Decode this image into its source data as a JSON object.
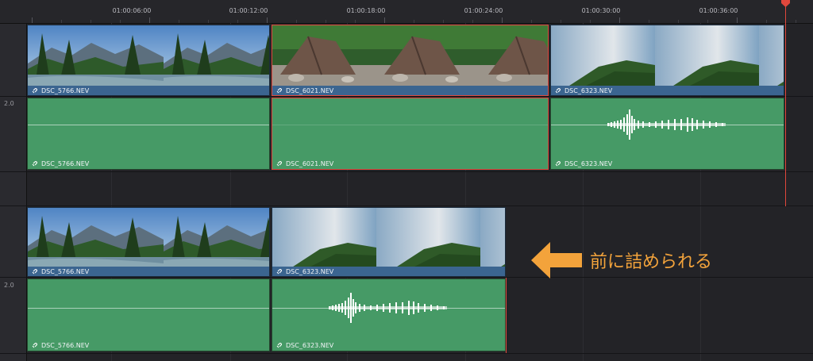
{
  "ruler": {
    "timecodes": [
      "01:00:06:00",
      "01:00:12:00",
      "01:00:18:00",
      "01:00:24:00",
      "01:00:30:00",
      "01:00:36:00"
    ]
  },
  "tracks": {
    "audio_level_top": "2.0",
    "audio_level_bottom": "2.0"
  },
  "timeline_before": {
    "video_clips": [
      {
        "name": "DSC_5766.NEV",
        "thumbnail": "mountain-river",
        "selected": false
      },
      {
        "name": "DSC_6021.NEV",
        "thumbnail": "tent",
        "selected": true
      },
      {
        "name": "DSC_6323.NEV",
        "thumbnail": "sky-hill",
        "selected": false
      }
    ],
    "audio_clips": [
      {
        "name": "DSC_5766.NEV",
        "waveform": "quiet",
        "selected": false
      },
      {
        "name": "DSC_6021.NEV",
        "waveform": "silent",
        "selected": true
      },
      {
        "name": "DSC_6323.NEV",
        "waveform": "burst",
        "selected": false
      }
    ]
  },
  "timeline_after": {
    "video_clips": [
      {
        "name": "DSC_5766.NEV",
        "thumbnail": "mountain-river"
      },
      {
        "name": "DSC_6323.NEV",
        "thumbnail": "sky-hill"
      }
    ],
    "audio_clips": [
      {
        "name": "DSC_5766.NEV",
        "waveform": "quiet"
      },
      {
        "name": "DSC_6323.NEV",
        "waveform": "burst"
      }
    ]
  },
  "annotation": {
    "text": "前に詰められる",
    "icon": "left-arrow-icon"
  },
  "colors": {
    "accent": "#f3a33b",
    "playhead": "#e0473c",
    "video_clip": "#3f6f9f",
    "audio_clip": "#469a66"
  }
}
